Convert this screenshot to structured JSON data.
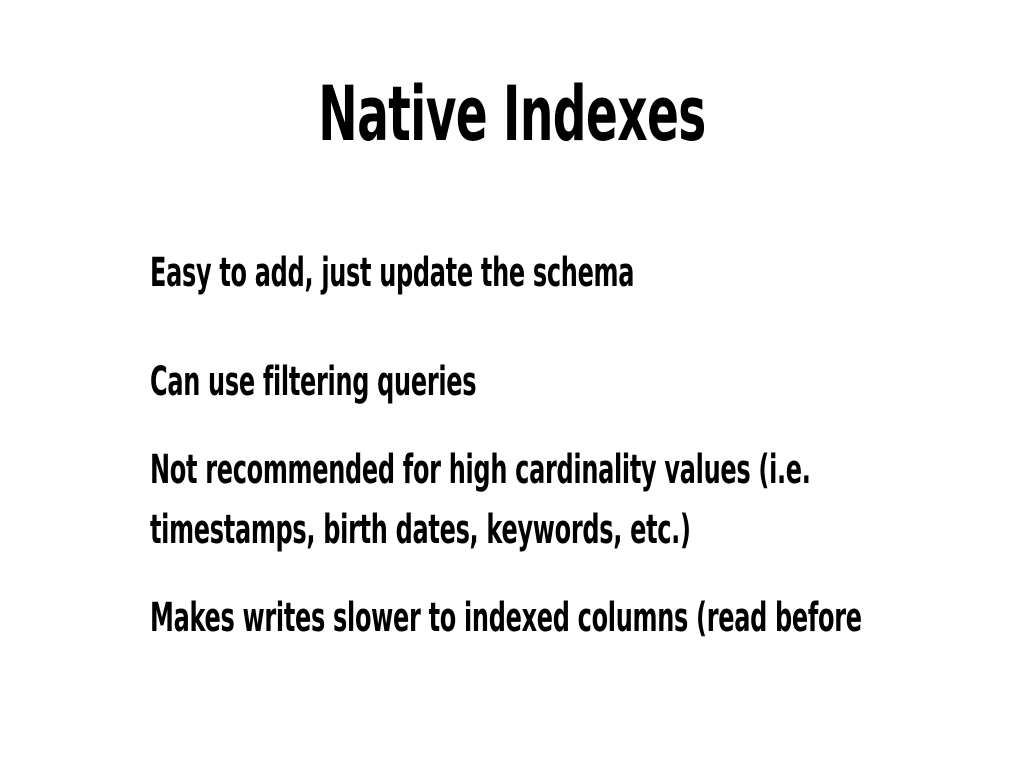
{
  "slide": {
    "title": "Native Indexes",
    "bullets": [
      "Easy to add, just update the schema",
      "Can use filtering queries",
      {
        "line1": "Not recommended for high cardinality values (i.e.",
        "line2": "timestamps, birth dates, keywords, etc.)"
      },
      "Makes writes slower to indexed columns (read before"
    ]
  }
}
